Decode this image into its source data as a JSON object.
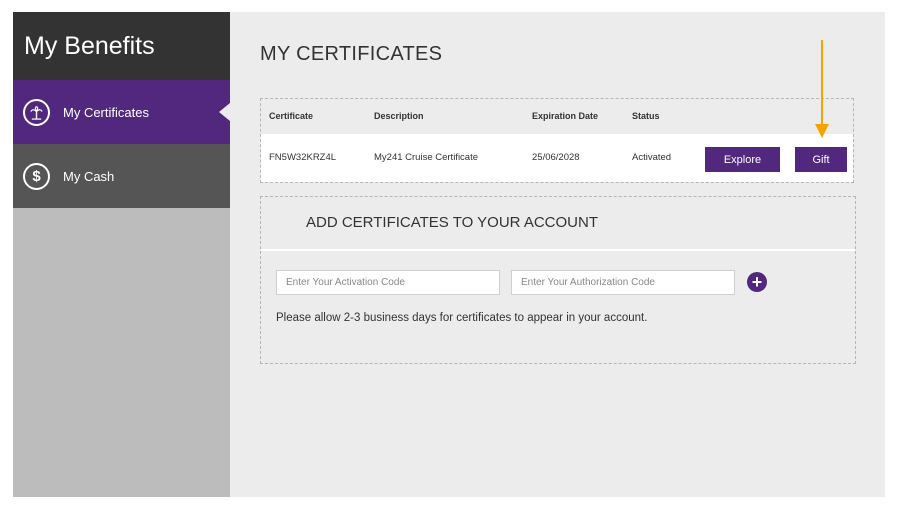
{
  "sidebar": {
    "title": "My Benefits",
    "items": [
      {
        "label": "My Certificates",
        "icon": "palm-tree-icon",
        "active": true
      },
      {
        "label": "My Cash",
        "icon": "dollar-icon",
        "active": false
      }
    ]
  },
  "main": {
    "title": "MY CERTIFICATES",
    "table": {
      "headers": [
        "Certificate",
        "Description",
        "Expiration Date",
        "Status"
      ],
      "rows": [
        {
          "certificate": "FN5W32KRZ4L",
          "description": "My241 Cruise Certificate",
          "expiration": "25/06/2028",
          "status": "Activated",
          "explore_label": "Explore",
          "gift_label": "Gift"
        }
      ]
    },
    "add": {
      "title": "ADD CERTIFICATES TO YOUR ACCOUNT",
      "activation_placeholder": "Enter Your Activation Code",
      "authorization_placeholder": "Enter Your Authorization Code",
      "note": "Please allow 2-3 business days for certificates to appear in your account."
    }
  },
  "colors": {
    "accent": "#52287f",
    "sidebar_dark": "#333333",
    "sidebar_inactive": "#555555",
    "arrow": "#f5a300"
  }
}
